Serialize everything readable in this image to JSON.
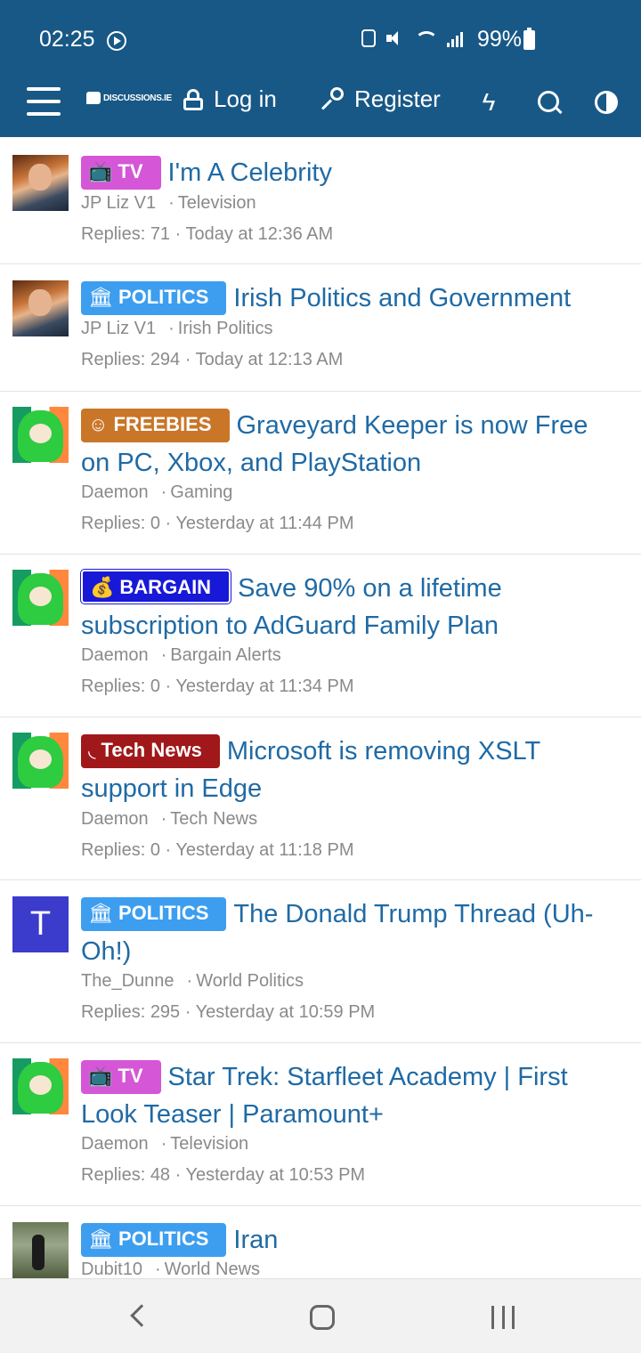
{
  "status": {
    "time": "02:25",
    "battery": "99%"
  },
  "header": {
    "logo_text": "DISCUSSIONS.IE",
    "login_label": "Log in",
    "register_label": "Register",
    "bg_color": "#185886"
  },
  "threads": [
    {
      "prefix": "TV",
      "prefix_icon": "tv-icon",
      "title": "I'm A Celebrity",
      "author": "JP Liz V1",
      "forum": "Television",
      "replies": "Replies: 71",
      "date": "Today at 12:36 AM"
    },
    {
      "prefix": "POLITICS",
      "prefix_icon": "government-icon",
      "title": "Irish Politics and Government",
      "author": "JP Liz V1",
      "forum": "Irish Politics",
      "replies": "Replies: 294",
      "date": "Today at 12:13 AM"
    },
    {
      "prefix": "FREEBIES",
      "prefix_icon": "smile-icon",
      "title": "Graveyard Keeper is now Free on PC, Xbox, and PlayStation",
      "author": "Daemon",
      "forum": "Gaming",
      "replies": "Replies: 0",
      "date": "Yesterday at 11:44 PM"
    },
    {
      "prefix": "BARGAIN",
      "prefix_icon": "money-bag-icon",
      "title": "Save 90% on a lifetime subscription to AdGuard Family Plan",
      "author": "Daemon",
      "forum": "Bargain Alerts",
      "replies": "Replies: 0",
      "date": "Yesterday at 11:34 PM"
    },
    {
      "prefix": "Tech News",
      "prefix_icon": "rss-icon",
      "title": "Microsoft is removing XSLT support in Edge",
      "author": "Daemon",
      "forum": "Tech News",
      "replies": "Replies: 0",
      "date": "Yesterday at 11:18 PM"
    },
    {
      "prefix": "POLITICS",
      "prefix_icon": "government-icon",
      "title": "The Donald Trump Thread (Uh-Oh!)",
      "author": "The_Dunne",
      "avatar_letter": "T",
      "forum": "World Politics",
      "replies": "Replies: 295",
      "date": "Yesterday at 10:59 PM"
    },
    {
      "prefix": "TV",
      "prefix_icon": "tv-icon",
      "title": "Star Trek: Starfleet Academy | First Look Teaser | Paramount+",
      "author": "Daemon",
      "forum": "Television",
      "replies": "Replies: 48",
      "date": "Yesterday at 10:53 PM"
    },
    {
      "prefix": "POLITICS",
      "prefix_icon": "government-icon",
      "title": "Iran",
      "author": "Dubit10",
      "forum": "World News"
    }
  ]
}
